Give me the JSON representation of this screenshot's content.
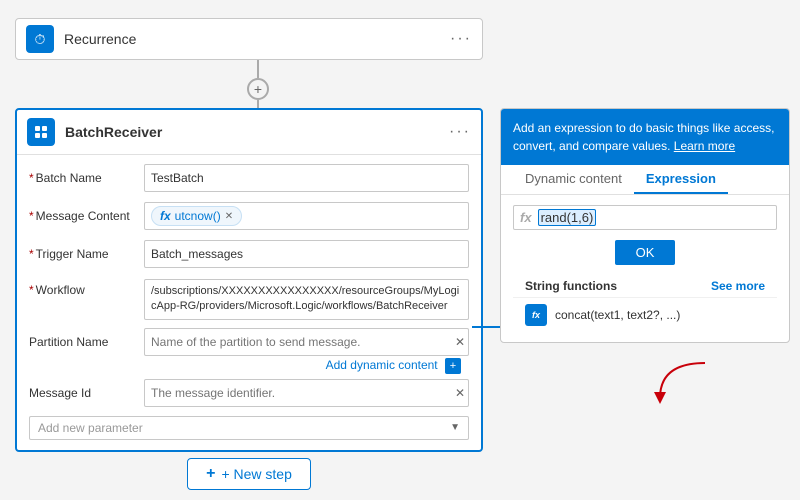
{
  "recurrence": {
    "title": "Recurrence",
    "icon": "⏱",
    "ellipsis": "···"
  },
  "connector": {
    "plus": "+"
  },
  "batchReceiver": {
    "title": "BatchReceiver",
    "icon": "⬛",
    "ellipsis": "···",
    "fields": {
      "batchName": {
        "label": "Batch Name",
        "required": true,
        "value": "TestBatch",
        "placeholder": ""
      },
      "messageContent": {
        "label": "Message Content",
        "required": true,
        "token": "utcnow()"
      },
      "triggerName": {
        "label": "Trigger Name",
        "required": true,
        "value": "Batch_messages"
      },
      "workflow": {
        "label": "Workflow",
        "required": true,
        "value": "/subscriptions/XXXXXXXXXXXXXXXX/resourceGroups/MyLogicApp-RG/providers/Microsoft.Logic/workflows/BatchReceiver"
      },
      "partitionName": {
        "label": "Partition Name",
        "placeholder": "Name of the partition to send message.",
        "dynamic_link": "Add dynamic content"
      },
      "messageId": {
        "label": "Message Id",
        "placeholder": "The message identifier."
      },
      "addParam": {
        "placeholder": "Add new parameter"
      }
    }
  },
  "newStep": {
    "label": "+ New step"
  },
  "rightPanel": {
    "header_text": "Add an expression to do basic things like access, convert, and compare values.",
    "header_link": "Learn more",
    "tabs": [
      {
        "label": "Dynamic content",
        "active": false
      },
      {
        "label": "Expression",
        "active": true
      }
    ],
    "expression": {
      "fx_label": "fx",
      "value": "rand(1,6)",
      "highlight": "rand(1,6)"
    },
    "ok_button": "OK",
    "string_functions": {
      "label": "String functions",
      "see_more": "See more",
      "items": [
        {
          "name": "concat(text1, text2?, ...)"
        }
      ]
    }
  }
}
